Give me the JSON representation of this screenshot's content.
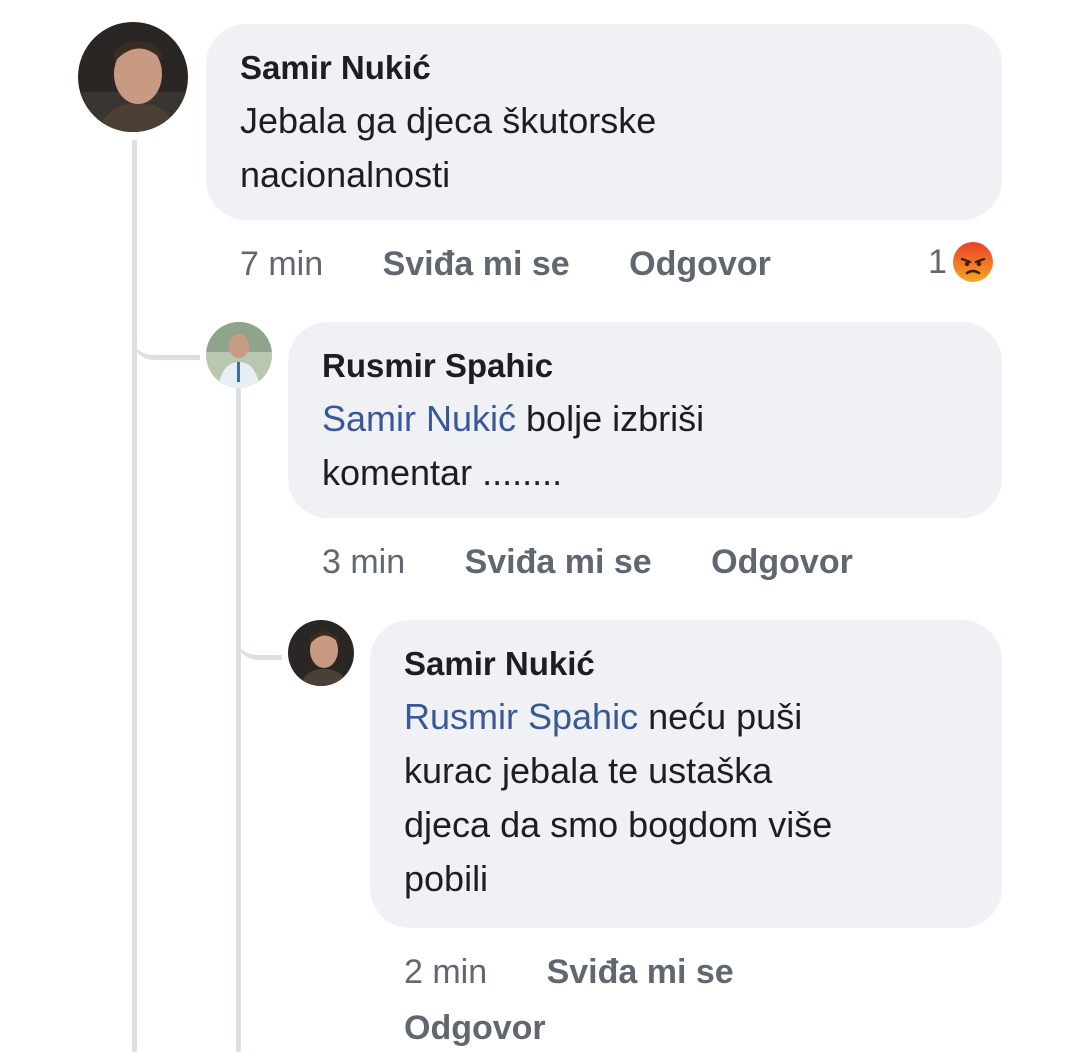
{
  "comments": [
    {
      "author": "Samir Nukić",
      "mention": "",
      "text_lines": [
        "Jebala ga djeca škutorske",
        "nacionalnosti"
      ],
      "time": "7 min",
      "like_label": "Sviđa mi se",
      "reply_label": "Odgovor",
      "reaction_count": "1",
      "reaction_icon": "angry-face-icon"
    },
    {
      "author": "Rusmir Spahic",
      "mention": "Samir Nukić",
      "text_first": " bolje izbriši",
      "text_lines": [
        "komentar ........"
      ],
      "time": "3 min",
      "like_label": "Sviđa mi se",
      "reply_label": "Odgovor"
    },
    {
      "author": "Samir Nukić",
      "mention": "Rusmir Spahic",
      "text_first": " neću puši",
      "text_lines": [
        "kurac jebala te ustaška",
        "djeca da smo bogdom više",
        "pobili"
      ],
      "time": "2 min",
      "like_label": "Sviđa mi se",
      "reply_label": "Odgovor"
    }
  ],
  "colors": {
    "bubble": "#eff1f5",
    "mention": "#385898",
    "meta": "#606770",
    "thread_line": "#dcdfe4",
    "angry_reaction": "#f0761b"
  }
}
